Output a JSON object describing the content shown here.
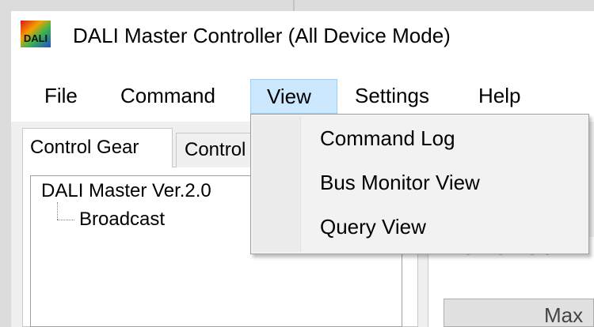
{
  "window": {
    "title": "DALI Master Controller (All Device Mode)",
    "icon": "dali-app-icon",
    "icon_text": "DALI"
  },
  "menubar": {
    "items": [
      {
        "label": "File"
      },
      {
        "label": "Command"
      },
      {
        "label": "View"
      },
      {
        "label": "Settings"
      },
      {
        "label": "Help"
      }
    ],
    "open_menu": "View"
  },
  "view_menu": {
    "items": [
      {
        "label": "Command Log"
      },
      {
        "label": "Bus Monitor View"
      },
      {
        "label": "Query View"
      }
    ]
  },
  "tabs": [
    {
      "label": "Control Gear",
      "active": true
    },
    {
      "label": "Control",
      "active": false
    }
  ],
  "tree": {
    "root": "DALI Master Ver.2.0",
    "children": [
      {
        "label": "Broadcast"
      }
    ]
  },
  "right_panel": {
    "heading": "Power Co",
    "button_label": "Max"
  },
  "colors": {
    "menu_highlight": "#cce8ff",
    "menu_highlight_border": "#99d1ff",
    "dropdown_bg": "#f2f2f2"
  }
}
